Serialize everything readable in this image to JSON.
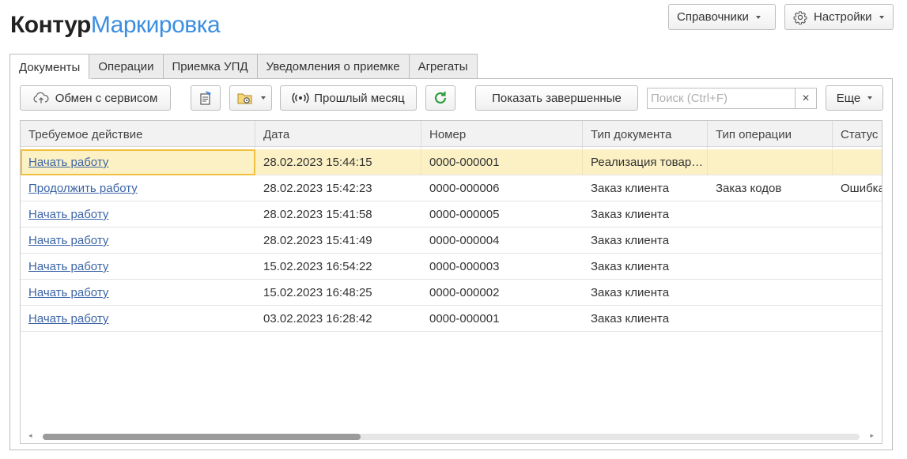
{
  "app": {
    "logo_part1": "Контур",
    "logo_part2": "Маркировка"
  },
  "top_buttons": {
    "references": "Справочники",
    "settings": "Настройки"
  },
  "tabs": [
    {
      "label": "Документы",
      "active": true
    },
    {
      "label": "Операции",
      "active": false
    },
    {
      "label": "Приемка УПД",
      "active": false
    },
    {
      "label": "Уведомления о приемке",
      "active": false
    },
    {
      "label": "Агрегаты",
      "active": false
    }
  ],
  "toolbar": {
    "exchange": "Обмен с сервисом",
    "period": "Прошлый месяц",
    "show_completed": "Показать завершенные",
    "search_placeholder": "Поиск (Ctrl+F)",
    "clear": "×",
    "more": "Еще"
  },
  "table": {
    "columns": [
      "Требуемое действие",
      "Дата",
      "Номер",
      "Тип документа",
      "Тип операции",
      "Статус"
    ],
    "rows": [
      [
        "Начать работу",
        "28.02.2023 15:44:15",
        "0000-000001",
        "Реализация товаров и услуг",
        "",
        ""
      ],
      [
        "Продолжить работу",
        "28.02.2023 15:42:23",
        "0000-000006",
        "Заказ клиента",
        "Заказ кодов",
        "Ошибка"
      ],
      [
        "Начать работу",
        "28.02.2023 15:41:58",
        "0000-000005",
        "Заказ клиента",
        "",
        ""
      ],
      [
        "Начать работу",
        "28.02.2023 15:41:49",
        "0000-000004",
        "Заказ клиента",
        "",
        ""
      ],
      [
        "Начать работу",
        "15.02.2023 16:54:22",
        "0000-000003",
        "Заказ клиента",
        "",
        ""
      ],
      [
        "Начать работу",
        "15.02.2023 16:48:25",
        "0000-000002",
        "Заказ клиента",
        "",
        ""
      ],
      [
        "Начать работу",
        "03.02.2023 16:28:42",
        "0000-000001",
        "Заказ клиента",
        "",
        ""
      ]
    ],
    "selected_row": 0
  },
  "colors": {
    "accent": "#3c8fe0",
    "link": "#3a63a5",
    "selection": "#fcf1c4",
    "focus": "#f0c040"
  },
  "icons": [
    "cloud-upload-icon",
    "report-icon",
    "folder-gear-icon",
    "broadcast-icon",
    "refresh-icon",
    "gear-icon"
  ]
}
